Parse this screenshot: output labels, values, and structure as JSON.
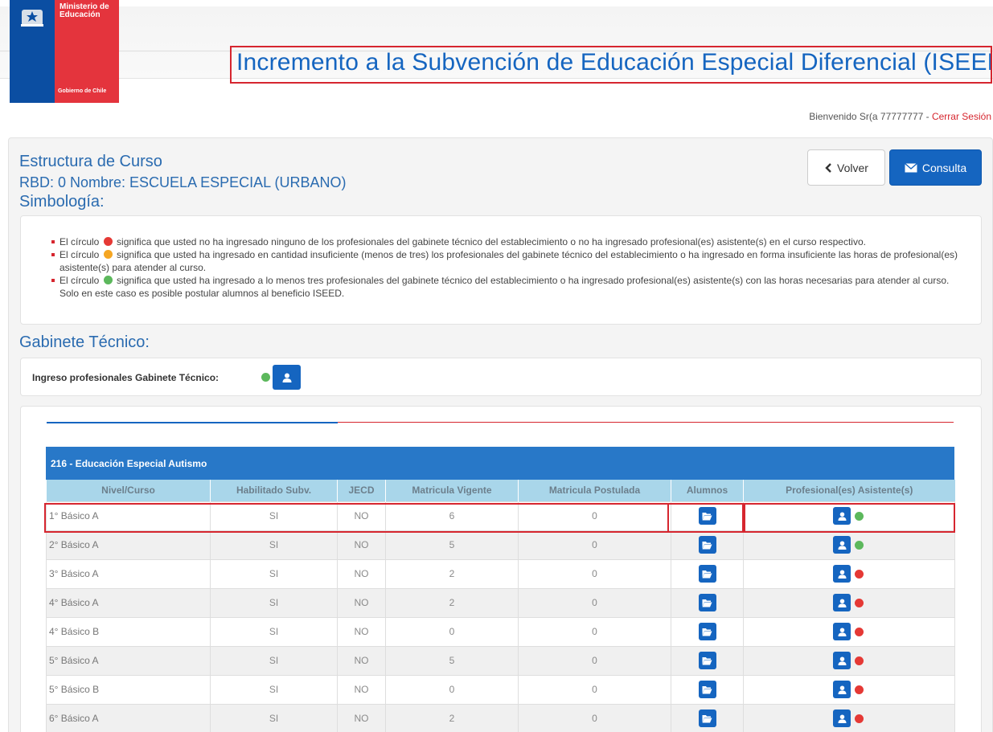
{
  "header": {
    "ministry_line1": "Ministerio de",
    "ministry_line2": "Educación",
    "government": "Gobierno de Chile",
    "app_title": "Incremento a la Subvención de Educación Especial Diferencial (ISEED)"
  },
  "session": {
    "welcome": "Bienvenido Sr(a 77777777",
    "separator": " - ",
    "logout": "Cerrar Sesión"
  },
  "page": {
    "title": "Estructura de Curso",
    "rbd": "RBD: 0 Nombre: ESCUELA ESPECIAL (URBANO)",
    "symbology_title": "Simbología:"
  },
  "actions": {
    "back_label": "Volver",
    "consult_label": "Consulta"
  },
  "legend": [
    {
      "dot": "red",
      "before": "El círculo",
      "after": "significa que usted no ha ingresado ninguno de los profesionales del gabinete técnico del establecimiento o no ha ingresado profesional(es) asistente(s) en el curso respectivo."
    },
    {
      "dot": "orange",
      "before": "El círculo",
      "after": "significa que usted ha ingresado en cantidad insuficiente (menos de tres) los profesionales del gabinete técnico del establecimiento o ha ingresado en forma insuficiente las horas de profesional(es) asistente(s) para atender al curso."
    },
    {
      "dot": "green",
      "before": "El círculo",
      "after": "significa que usted ha ingresado a lo menos tres profesionales del gabinete técnico del establecimiento o ha ingresado profesional(es) asistente(s) con las horas necesarias para atender al curso. Solo en este caso es posible postular alumnos al beneficio ISEED."
    }
  ],
  "gabinete": {
    "title": "Gabinete Técnico:",
    "label": "Ingreso profesionales Gabinete Técnico:",
    "status": "green"
  },
  "course_table": {
    "caption": "216 - Educación Especial Autismo",
    "columns": [
      "Nivel/Curso",
      "Habilitado Subv.",
      "JECD",
      "Matricula Vigente",
      "Matricula Postulada",
      "Alumnos",
      "Profesional(es) Asistente(s)"
    ],
    "rows": [
      {
        "nivel": "1° Básico A",
        "habilitado": "SI",
        "jecd": "NO",
        "vigente": "6",
        "postulada": "0",
        "status": "green"
      },
      {
        "nivel": "2° Básico A",
        "habilitado": "SI",
        "jecd": "NO",
        "vigente": "5",
        "postulada": "0",
        "status": "green"
      },
      {
        "nivel": "3° Básico A",
        "habilitado": "SI",
        "jecd": "NO",
        "vigente": "2",
        "postulada": "0",
        "status": "red"
      },
      {
        "nivel": "4° Básico A",
        "habilitado": "SI",
        "jecd": "NO",
        "vigente": "2",
        "postulada": "0",
        "status": "red"
      },
      {
        "nivel": "4° Básico B",
        "habilitado": "SI",
        "jecd": "NO",
        "vigente": "0",
        "postulada": "0",
        "status": "red"
      },
      {
        "nivel": "5° Básico A",
        "habilitado": "SI",
        "jecd": "NO",
        "vigente": "5",
        "postulada": "0",
        "status": "red"
      },
      {
        "nivel": "5° Básico B",
        "habilitado": "SI",
        "jecd": "NO",
        "vigente": "0",
        "postulada": "0",
        "status": "red"
      },
      {
        "nivel": "6° Básico A",
        "habilitado": "SI",
        "jecd": "NO",
        "vigente": "2",
        "postulada": "0",
        "status": "red"
      }
    ]
  },
  "colors": {
    "brand_blue": "#1565c0",
    "brand_red": "#d6262f",
    "status_red": "#e53935",
    "status_orange": "#f5a623",
    "status_green": "#5cb85c"
  }
}
